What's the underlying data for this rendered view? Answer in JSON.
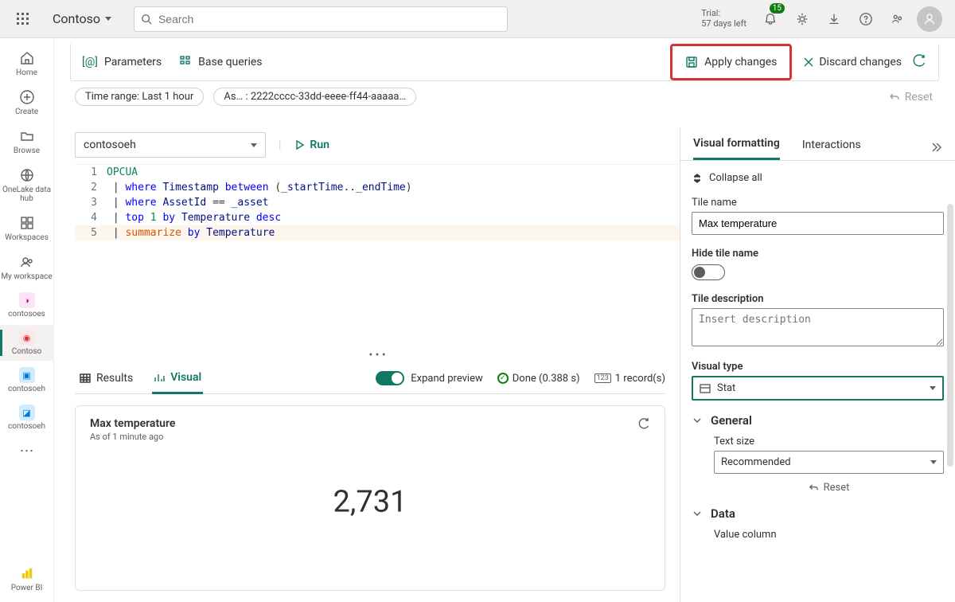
{
  "topbar": {
    "workspace_name": "Contoso",
    "search_placeholder": "Search",
    "trial_label": "Trial:",
    "trial_remaining": "57 days left",
    "notif_count": "15"
  },
  "leftrail": {
    "home": "Home",
    "create": "Create",
    "browse": "Browse",
    "onelake": "OneLake data hub",
    "workspaces": "Workspaces",
    "my_workspace": "My workspace",
    "contosoes": "contosoes",
    "contoso": "Contoso",
    "contosoeh1": "contosoeh",
    "contosoeh2": "contosoeh",
    "powerbi": "Power BI"
  },
  "toolbar": {
    "parameters": "Parameters",
    "base_queries": "Base queries",
    "apply_changes": "Apply changes",
    "discard_changes": "Discard changes"
  },
  "filters": {
    "time_range": "Time range: Last 1 hour",
    "asset": "As… : 2222cccc-33dd-eeee-ff44-aaaaa…",
    "reset": "Reset"
  },
  "datasource": {
    "selected": "contosoeh",
    "run_label": "Run"
  },
  "query": {
    "lines": [
      "OPCUA",
      " | where Timestamp between (_startTime.._endTime)",
      " | where AssetId == _asset",
      " | top 1 by Temperature desc",
      " | summarize by Temperature"
    ]
  },
  "results": {
    "tab_results": "Results",
    "tab_visual": "Visual",
    "expand_preview": "Expand preview",
    "done_label": "Done (0.388 s)",
    "record_count": "1 record(s)"
  },
  "visual": {
    "tile_title": "Max temperature",
    "subtitle": "As of 1 minute ago",
    "stat_value": "2,731"
  },
  "panel": {
    "tab_formatting": "Visual formatting",
    "tab_interactions": "Interactions",
    "collapse_all": "Collapse all",
    "tile_name_label": "Tile name",
    "tile_name_value": "Max temperature",
    "hide_tile_label": "Hide tile name",
    "tile_desc_label": "Tile description",
    "tile_desc_placeholder": "Insert description",
    "visual_type_label": "Visual type",
    "visual_type_value": "Stat",
    "section_general": "General",
    "text_size_label": "Text size",
    "text_size_value": "Recommended",
    "reset_small": "Reset",
    "section_data": "Data",
    "value_column_label": "Value column"
  }
}
